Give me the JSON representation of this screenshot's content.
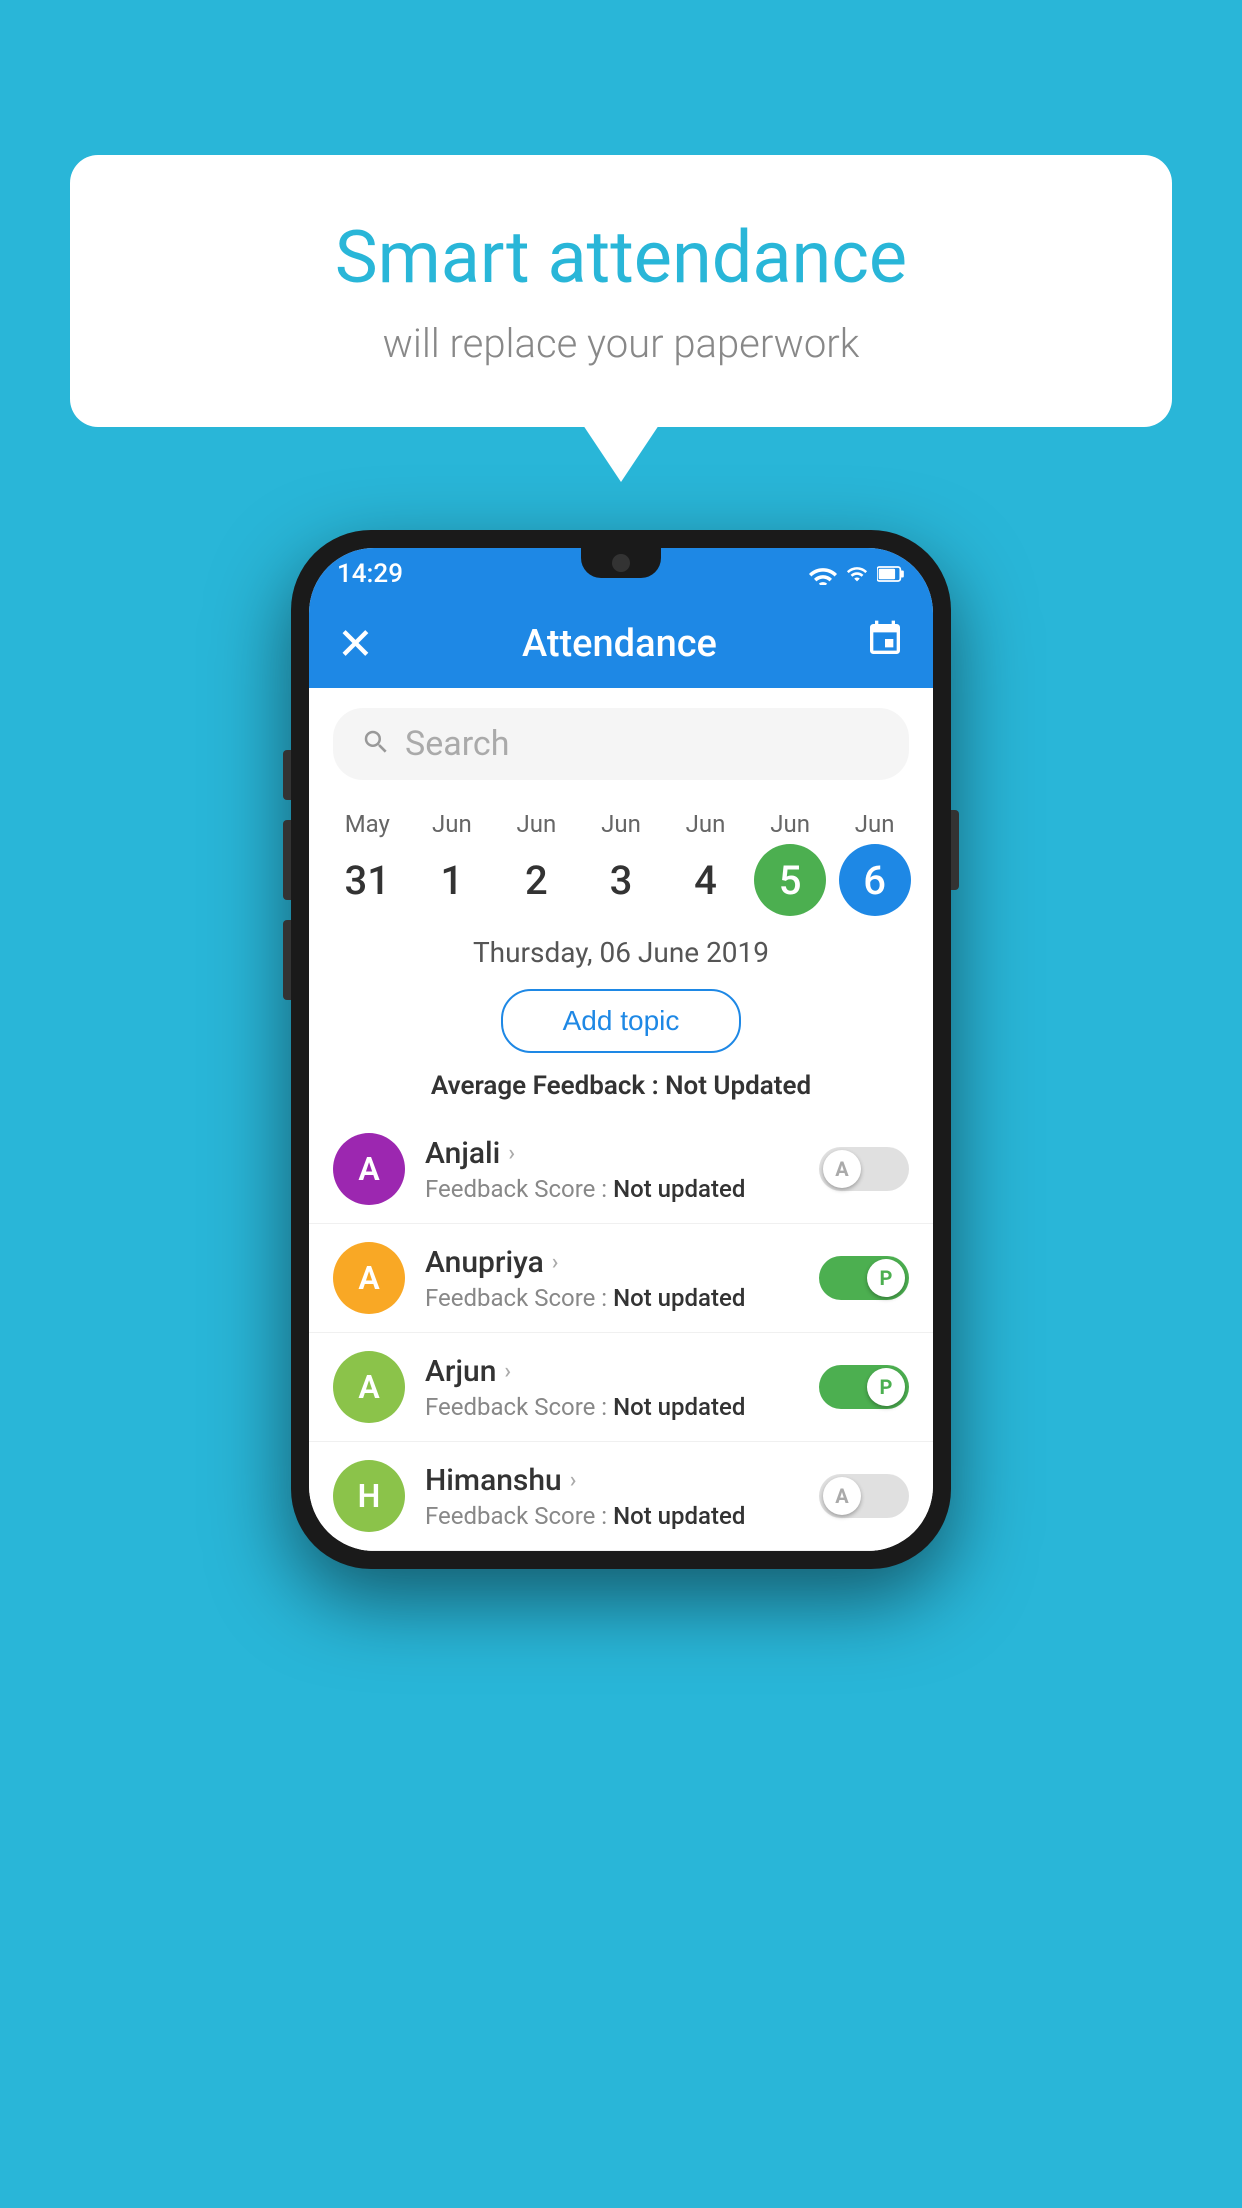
{
  "background_color": "#29b6d8",
  "bubble": {
    "title": "Smart attendance",
    "subtitle": "will replace your paperwork"
  },
  "phone": {
    "status_bar": {
      "time": "14:29",
      "wifi_icon": "wifi",
      "signal_icon": "signal",
      "battery_icon": "battery"
    },
    "app_bar": {
      "close_icon": "×",
      "title": "Attendance",
      "calendar_icon": "📅"
    },
    "search": {
      "placeholder": "Search"
    },
    "calendar": {
      "dates": [
        {
          "month": "May",
          "day": "31",
          "style": "normal"
        },
        {
          "month": "Jun",
          "day": "1",
          "style": "normal"
        },
        {
          "month": "Jun",
          "day": "2",
          "style": "normal"
        },
        {
          "month": "Jun",
          "day": "3",
          "style": "normal"
        },
        {
          "month": "Jun",
          "day": "4",
          "style": "normal"
        },
        {
          "month": "Jun",
          "day": "5",
          "style": "today"
        },
        {
          "month": "Jun",
          "day": "6",
          "style": "selected"
        }
      ]
    },
    "selected_date": "Thursday, 06 June 2019",
    "add_topic_label": "Add topic",
    "average_feedback_label": "Average Feedback : ",
    "average_feedback_value": "Not Updated",
    "students": [
      {
        "name": "Anjali",
        "avatar_letter": "A",
        "avatar_color": "#9c27b0",
        "feedback_score_label": "Feedback Score : ",
        "feedback_score_value": "Not updated",
        "attendance": "absent",
        "toggle_letter": "A"
      },
      {
        "name": "Anupriya",
        "avatar_letter": "A",
        "avatar_color": "#f9a825",
        "feedback_score_label": "Feedback Score : ",
        "feedback_score_value": "Not updated",
        "attendance": "present",
        "toggle_letter": "P"
      },
      {
        "name": "Arjun",
        "avatar_letter": "A",
        "avatar_color": "#8bc34a",
        "feedback_score_label": "Feedback Score : ",
        "feedback_score_value": "Not updated",
        "attendance": "present",
        "toggle_letter": "P"
      },
      {
        "name": "Himanshu",
        "avatar_letter": "H",
        "avatar_color": "#8bc34a",
        "feedback_score_label": "Feedback Score : ",
        "feedback_score_value": "Not updated",
        "attendance": "absent",
        "toggle_letter": "A"
      }
    ]
  }
}
